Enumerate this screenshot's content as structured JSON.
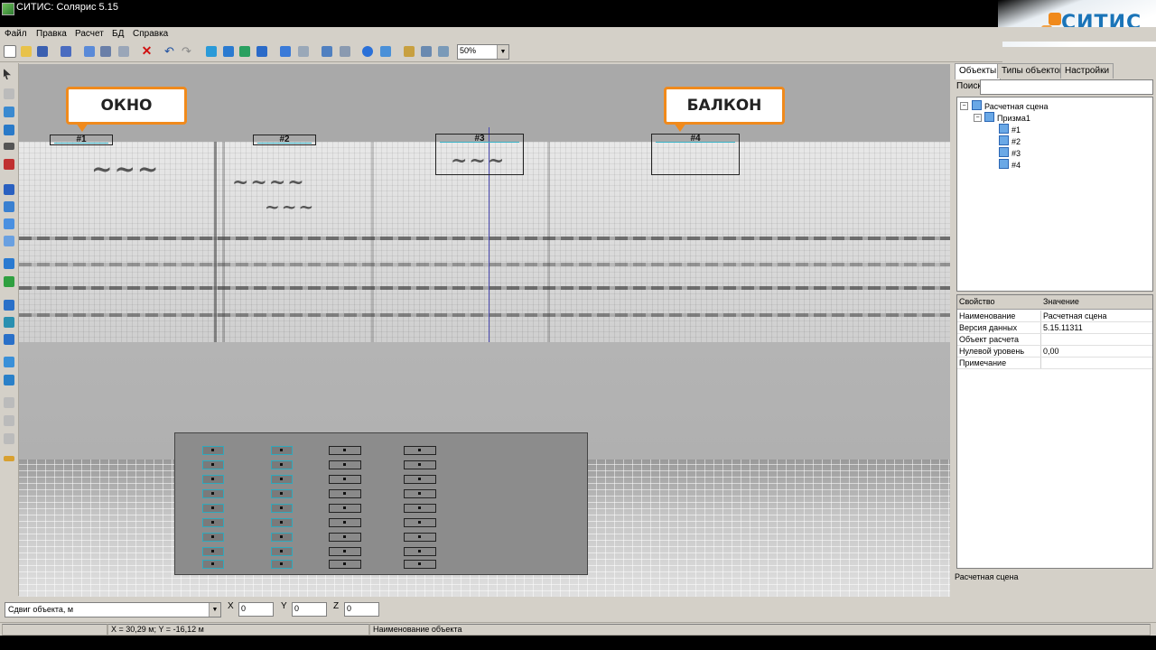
{
  "window": {
    "title": "СИТИС: Солярис 5.15"
  },
  "logo": {
    "text": "СИТИС"
  },
  "menu": [
    "Файл",
    "Правка",
    "Расчет",
    "БД",
    "Справка"
  ],
  "toolbar": {
    "zoom": "50%"
  },
  "viewport": {
    "callouts": {
      "window": "ОКНО",
      "balcony": "БАЛКОН"
    },
    "markers": [
      "#1",
      "#2",
      "#3",
      "#4"
    ]
  },
  "panel": {
    "tabs": [
      "Объекты",
      "Типы объектов",
      "Настройки"
    ],
    "search_label": "Поиск",
    "tree": {
      "root": "Расчетная сцена",
      "child": "Призма1",
      "items": [
        "#1",
        "#2",
        "#3",
        "#4"
      ]
    },
    "props": {
      "headers": [
        "Свойство",
        "Значение"
      ],
      "rows": [
        {
          "k": "Наименование",
          "v": "Расчетная сцена"
        },
        {
          "k": "Версия данных",
          "v": "5.15.11311"
        },
        {
          "k": "Объект расчета",
          "v": ""
        },
        {
          "k": "Нулевой уровень",
          "v": "0,00"
        },
        {
          "k": "Примечание",
          "v": ""
        }
      ]
    },
    "description": "Расчетная сцена"
  },
  "bottom": {
    "shift_select": "Сдвиг объекта, м",
    "labels": {
      "x": "X",
      "y": "Y",
      "z": "Z"
    },
    "values": {
      "x": "0",
      "y": "0",
      "z": "0"
    }
  },
  "status": {
    "coords": "X = 30,29 м; Y = -16,12 м",
    "hint": "Наименование объекта"
  },
  "colors": {
    "accent_orange": "#f08a1c",
    "logo_blue": "#1a74b8",
    "window_cyan": "#2fa9bd"
  }
}
